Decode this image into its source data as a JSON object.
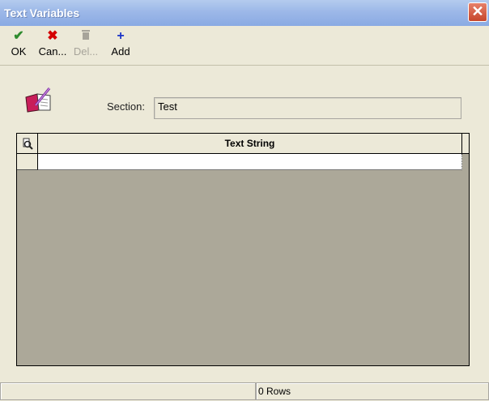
{
  "window": {
    "title": "Text Variables",
    "close_glyph": "✕"
  },
  "toolbar": {
    "buttons": [
      {
        "label": "OK",
        "icon": "check-icon",
        "glyph": "✔",
        "color": "#2e8b2e",
        "enabled": true
      },
      {
        "label": "Can...",
        "icon": "cancel-x-icon",
        "glyph": "✖",
        "color": "#d40000",
        "enabled": true
      },
      {
        "label": "Del...",
        "icon": "trash-icon",
        "glyph": "🗑",
        "color": "#a7a49a",
        "enabled": false
      },
      {
        "label": "Add",
        "icon": "plus-icon",
        "glyph": "+",
        "color": "#1b35c8",
        "enabled": true
      }
    ]
  },
  "section": {
    "label": "Section:",
    "value": "Test",
    "icon": "book-edit-icon"
  },
  "grid": {
    "corner_icon": "find-icon",
    "columns": [
      "Text String"
    ],
    "rows": [
      ""
    ]
  },
  "status": {
    "left": "",
    "right": "0 Rows"
  },
  "colors": {
    "window_bg": "#ece9d8",
    "titlebar": "#9cb8e8",
    "grid_empty": "#aca899",
    "close_button": "#c6462b"
  }
}
